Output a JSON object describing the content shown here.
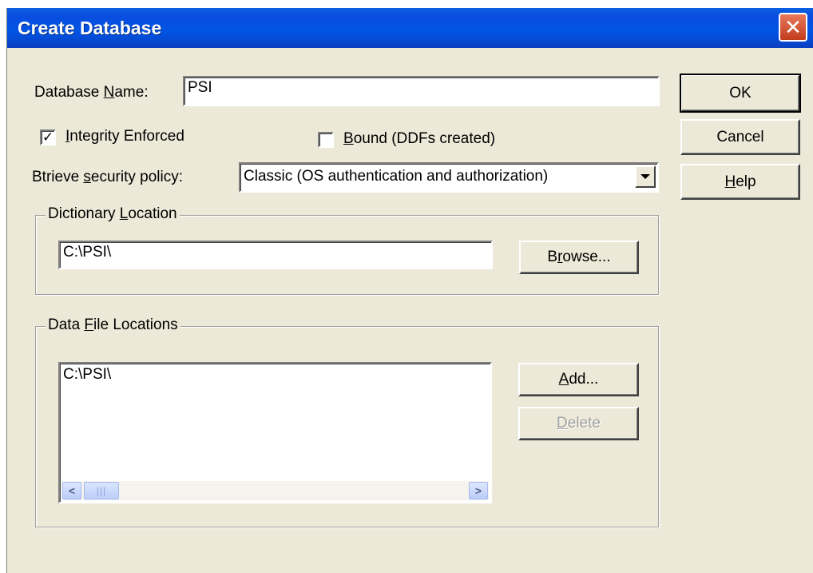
{
  "window": {
    "title": "Create Database",
    "close_glyph": "✕"
  },
  "form": {
    "db_name": {
      "label_pre": "Database ",
      "label_key": "N",
      "label_post": "ame:",
      "value": "PSI"
    },
    "integrity": {
      "label_pre": "",
      "label_key": "I",
      "label_post": "ntegrity Enforced",
      "checked": true,
      "check_glyph": "✓"
    },
    "bound": {
      "label_pre": "",
      "label_key": "B",
      "label_post": "ound (DDFs created)",
      "checked": false
    },
    "security": {
      "label_pre": "Btrieve ",
      "label_key": "s",
      "label_post": "ecurity policy:",
      "selected": "Classic (OS authentication and authorization)",
      "arrow_icon": "chevron-down-icon"
    }
  },
  "dictionary": {
    "title_pre": "Dictionary ",
    "title_key": "L",
    "title_post": "ocation",
    "path": "C:\\PSI\\",
    "browse_pre": "B",
    "browse_key": "r",
    "browse_post": "owse..."
  },
  "data_files": {
    "title_pre": "Data ",
    "title_key": "F",
    "title_post": "ile Locations",
    "items": [
      "C:\\PSI\\"
    ],
    "add_pre": "",
    "add_key": "A",
    "add_post": "dd...",
    "delete_pre": "",
    "delete_key": "D",
    "delete_post": "elete",
    "delete_enabled": false,
    "scroll_left": "<",
    "scroll_right": ">",
    "thumb_grip": "|||"
  },
  "buttons": {
    "ok": "OK",
    "cancel": "Cancel",
    "help_pre": "",
    "help_key": "H",
    "help_post": "elp"
  }
}
